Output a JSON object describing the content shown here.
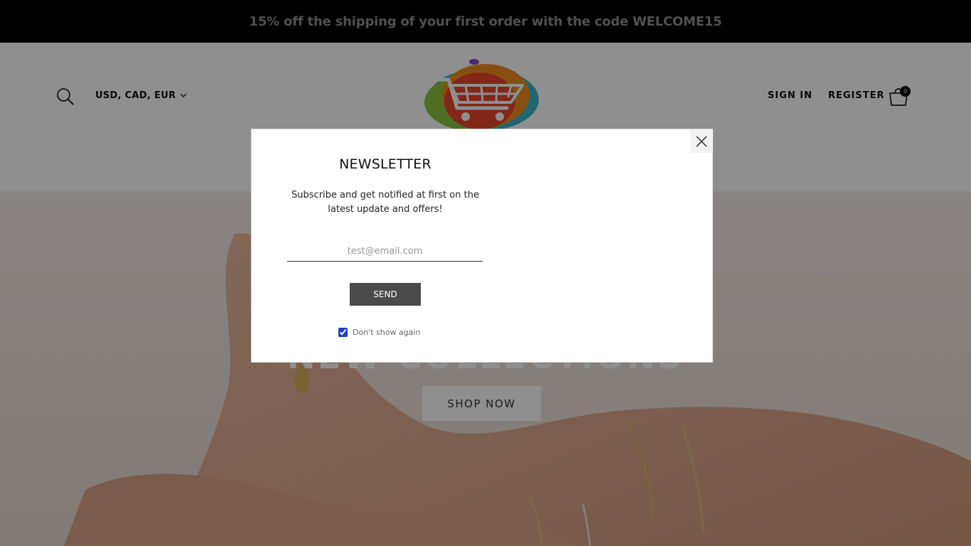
{
  "announcement": {
    "text": "15% off the shipping of your first order with the code WELCOME15"
  },
  "header": {
    "search_icon": "search-icon",
    "currency_label": "USD, CAD, EUR",
    "sign_in_label": "SIGN IN",
    "register_label": "REGISTER",
    "cart_count": "0",
    "logo_icon": "shopping-cart-logo"
  },
  "hero": {
    "title": "NEW COLLECTIONS",
    "shop_button_label": "SHOP NOW"
  },
  "newsletter": {
    "title": "NEWSLETTER",
    "description": "Subscribe and get notified at first on the latest update and offers!",
    "email_placeholder": "test@email.com",
    "send_label": "SEND",
    "dont_show_label": "Don't show again",
    "dont_show_checked": true,
    "close_icon": "close-icon"
  },
  "colors": {
    "announcement_bg": "#000000",
    "overlay": "rgba(0,0,0,0.44)",
    "send_button_bg": "#4a4a4a",
    "checkbox_accent": "#1f3fbf"
  }
}
